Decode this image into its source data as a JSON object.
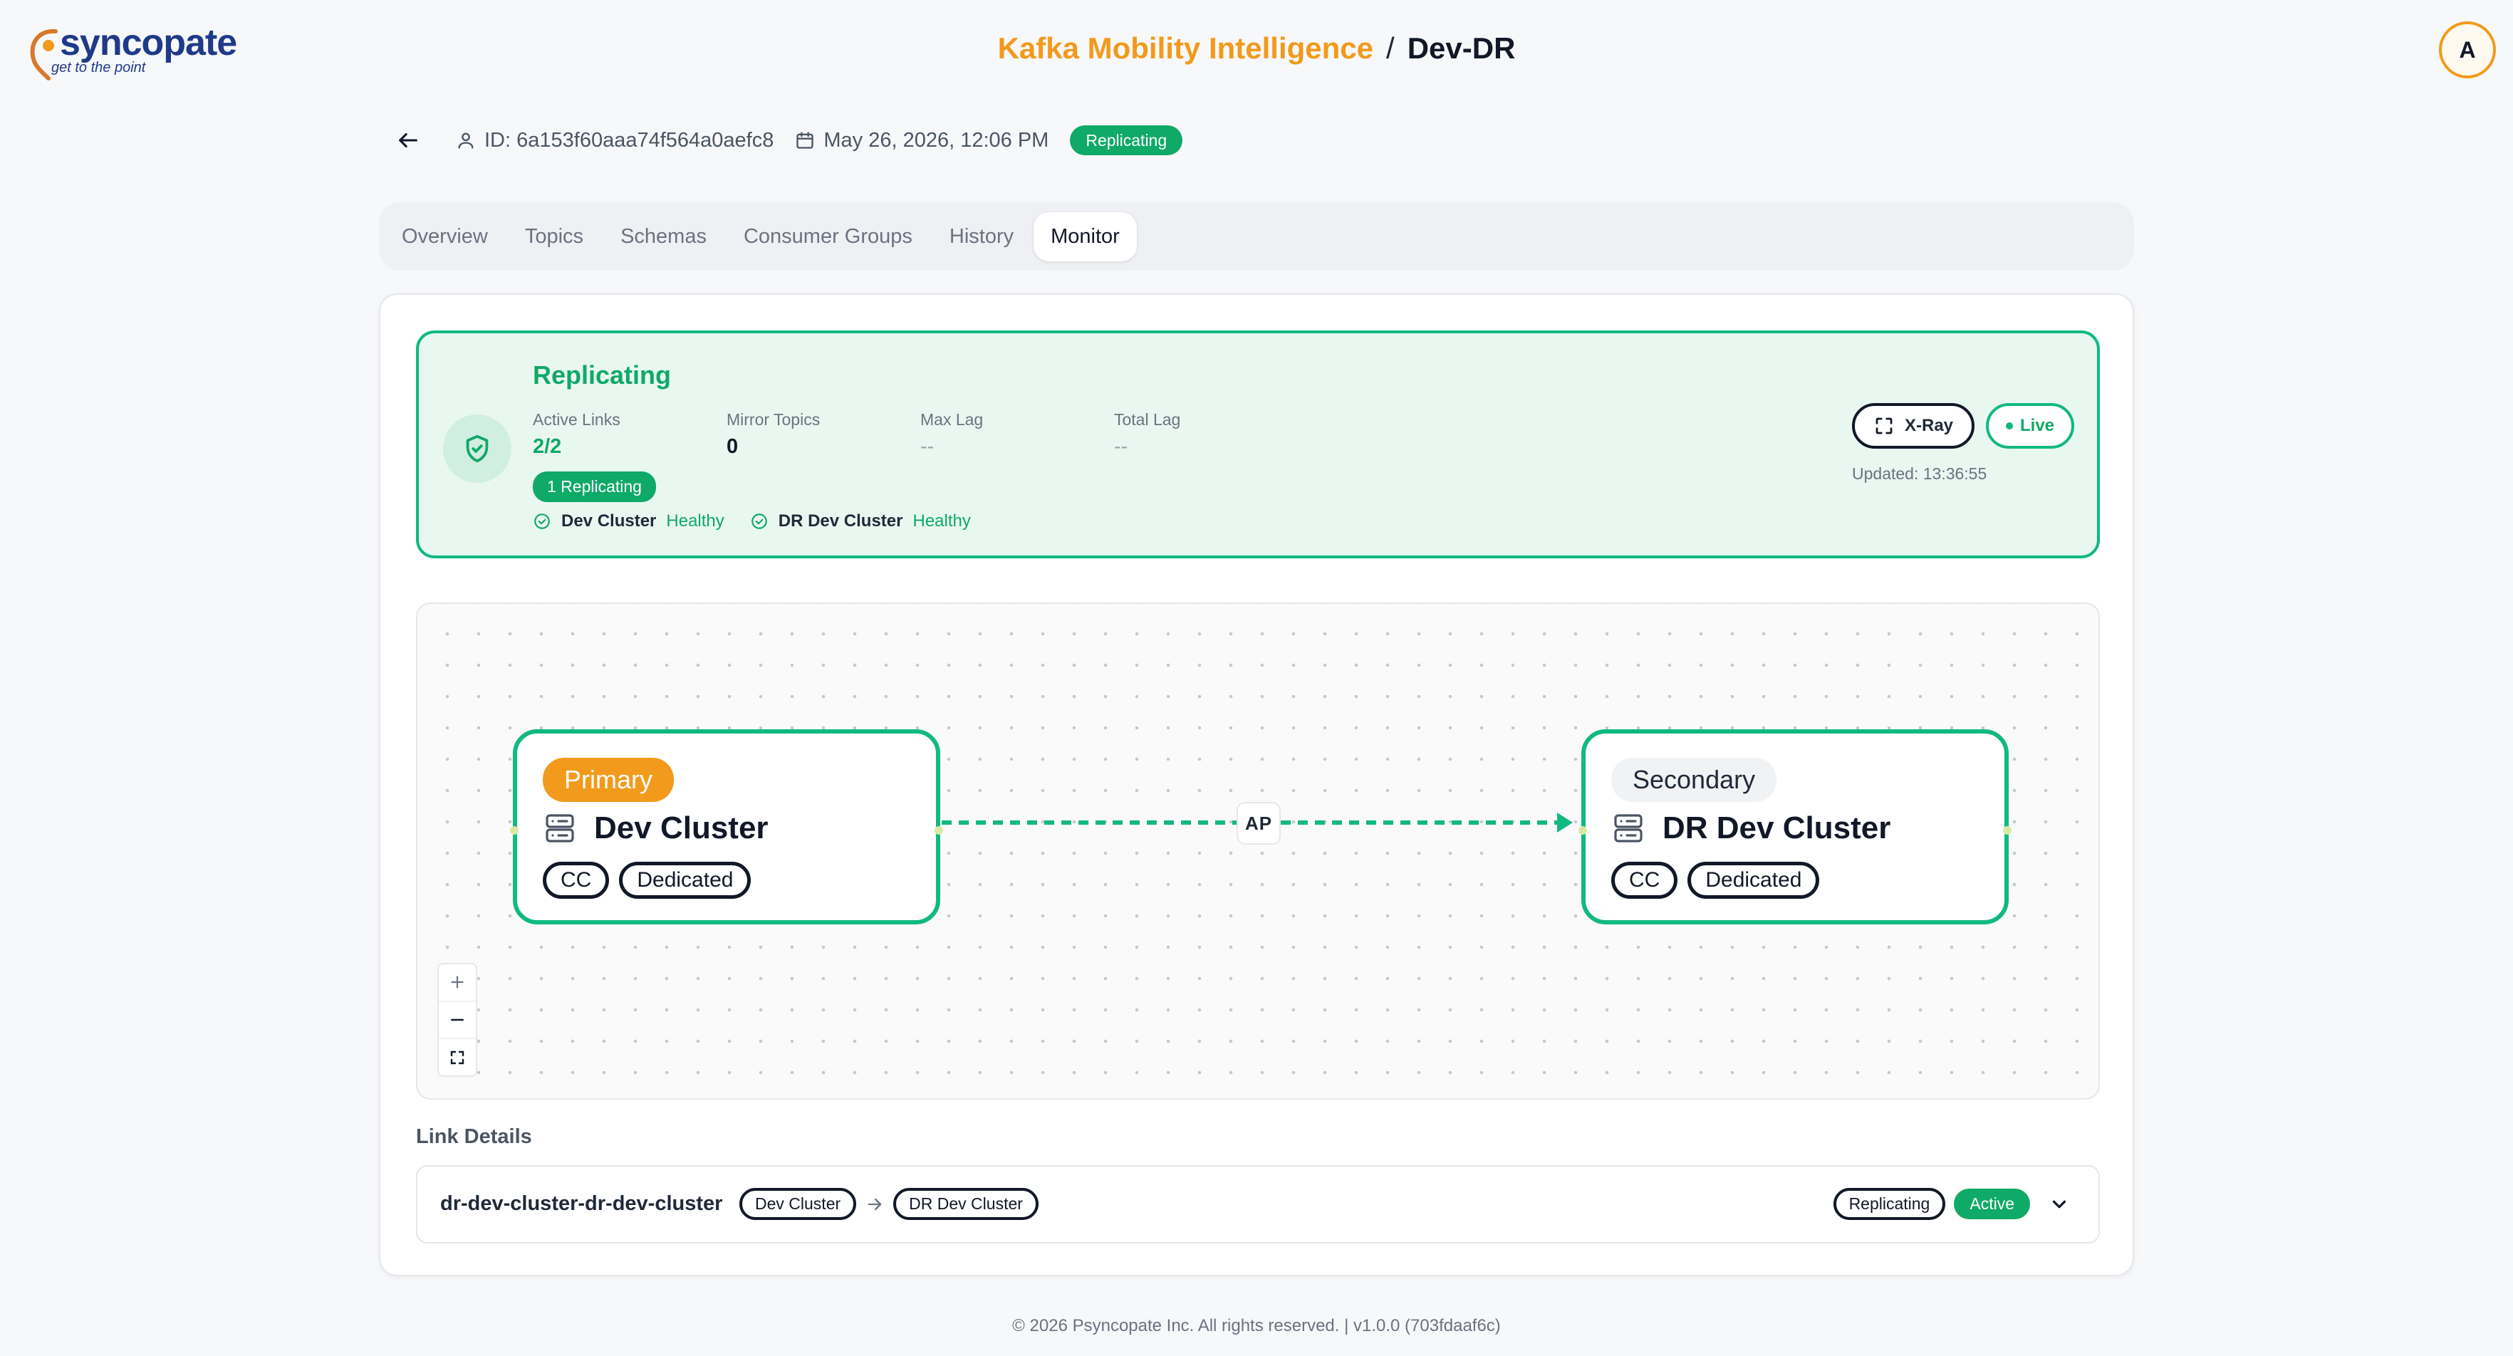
{
  "brand": {
    "name": "syncopate",
    "tagline": "get to the point"
  },
  "header": {
    "app_name": "Kafka Mobility Intelligence",
    "separator": "/",
    "current_page": "Dev-DR",
    "avatar_initial": "A"
  },
  "meta": {
    "id_text": "ID: 6a153f60aaa74f564a0aefc8",
    "date_text": "May 26, 2026, 12:06 PM",
    "status_badge": "Replicating"
  },
  "tabs": [
    {
      "label": "Overview",
      "active": false
    },
    {
      "label": "Topics",
      "active": false
    },
    {
      "label": "Schemas",
      "active": false
    },
    {
      "label": "Consumer Groups",
      "active": false
    },
    {
      "label": "History",
      "active": false
    },
    {
      "label": "Monitor",
      "active": true
    }
  ],
  "status_panel": {
    "title": "Replicating",
    "stats": [
      {
        "label": "Active Links",
        "value": "2/2"
      },
      {
        "label": "Mirror Topics",
        "value": "0"
      },
      {
        "label": "Max Lag",
        "value": "--"
      },
      {
        "label": "Total Lag",
        "value": "--"
      }
    ],
    "replicating_pill": "1 Replicating",
    "health": [
      {
        "name": "Dev Cluster",
        "state": "Healthy"
      },
      {
        "name": "DR Dev Cluster",
        "state": "Healthy"
      }
    ],
    "xray_label": "X-Ray",
    "live_label": "Live",
    "updated_text": "Updated: 13:36:55"
  },
  "topology": {
    "source": {
      "role": "Primary",
      "name": "Dev Cluster",
      "tags": [
        "CC",
        "Dedicated"
      ]
    },
    "target": {
      "role": "Secondary",
      "name": "DR Dev Cluster",
      "tags": [
        "CC",
        "Dedicated"
      ]
    },
    "edge_label": "AP",
    "zoom_in": "+",
    "zoom_out": "–"
  },
  "link_details": {
    "title": "Link Details",
    "link_name": "dr-dev-cluster-dr-dev-cluster",
    "source": "Dev Cluster",
    "target": "DR Dev Cluster",
    "status": "Replicating",
    "state": "Active"
  },
  "footer": {
    "text": "© 2026 Psyncopate Inc. All rights reserved. | v1.0.0 (703fdaaf6c)"
  },
  "colors": {
    "accent": "#f29a1b",
    "success": "#10b981",
    "success_dark": "#0fa968",
    "brand": "#1e3a8a"
  }
}
